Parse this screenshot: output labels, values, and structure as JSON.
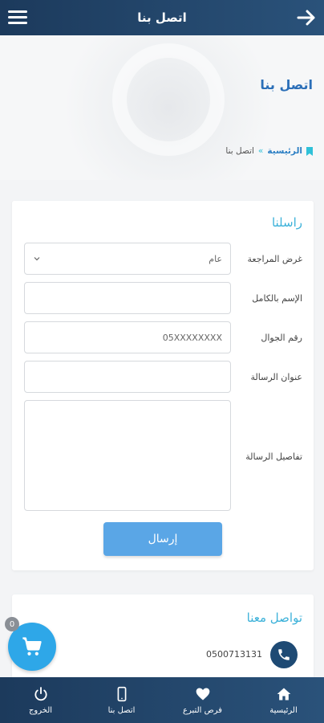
{
  "header": {
    "title": "اتصل بنا"
  },
  "page": {
    "title": "اتصل بنا",
    "breadcrumb": {
      "home": "الرئيسية",
      "separator": "»",
      "current": "اتصل بنا"
    }
  },
  "form": {
    "title": "راسلنا",
    "fields": {
      "purpose": {
        "label": "غرض المراجعة",
        "value": "عام"
      },
      "name": {
        "label": "الإسم بالكامل",
        "value": ""
      },
      "phone": {
        "label": "رقم الجوال",
        "placeholder": "05XXXXXXXX"
      },
      "subject": {
        "label": "عنوان الرسالة",
        "value": ""
      },
      "details": {
        "label": "تفاصيل الرسالة",
        "value": ""
      }
    },
    "submit_label": "إرسال"
  },
  "contact": {
    "title": "تواصل معنا",
    "phone": "0500713131"
  },
  "cart": {
    "count": "0"
  },
  "bottom_nav": [
    {
      "label": "الرئيسية",
      "icon": "home-icon"
    },
    {
      "label": "فرص التبرع",
      "icon": "heart-icon"
    },
    {
      "label": "اتصل بنا",
      "icon": "mobile-icon"
    },
    {
      "label": "الخروج",
      "icon": "power-icon"
    }
  ],
  "colors": {
    "header": "#1c3a5c",
    "accent": "#2b6fb8",
    "title_cyan": "#3bb1d9",
    "submit": "#5aa6e6",
    "fab": "#2ea7e8"
  }
}
